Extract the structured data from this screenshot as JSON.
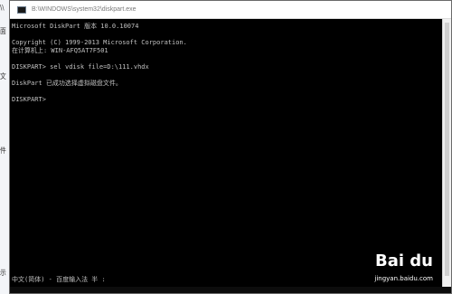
{
  "window": {
    "title": "B:\\WINDOWS\\system32\\diskpart.exe"
  },
  "console": {
    "lines": [
      "Microsoft DiskPart 版本 10.0.10074",
      "",
      "Copyright (C) 1999-2013 Microsoft Corporation.",
      "在计算机上: WIN-AFQ5AT7F501",
      "",
      "DISKPART> sel vdisk file=D:\\111.vhdx",
      "",
      "DiskPart 已成功选择虚拟磁盘文件。",
      "",
      "DISKPART>"
    ]
  },
  "ime_status": "中文(简体) - 百度输入法 半 :",
  "left_fragments": {
    "top": "\\\\",
    "a": "面",
    "b": "文",
    "c": "件",
    "d": "示"
  },
  "watermark": {
    "brand": "Bai du",
    "sub": "jingyan.baidu.com"
  }
}
